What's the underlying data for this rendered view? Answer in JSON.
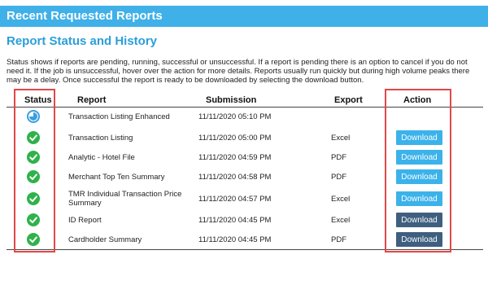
{
  "header": {
    "title": "Recent Requested Reports"
  },
  "section": {
    "title": "Report Status and History",
    "description": "Status shows if reports are pending, running, successful or unsuccessful. If a report is pending there is an option to cancel if you do not need it. If the job is unsuccessful, hover over the action for more details. Reports usually run quickly but during high volume peaks there may be a delay. Once successful the report is ready to be downloaded by selecting the download button."
  },
  "table": {
    "columns": {
      "status": "Status",
      "report": "Report",
      "submission": "Submission",
      "export": "Export",
      "action": "Action"
    },
    "rows": [
      {
        "status": "running",
        "report": "Transaction Listing Enhanced",
        "submission": "11/11/2020 05:10 PM",
        "export": "",
        "action": ""
      },
      {
        "status": "success",
        "report": "Transaction Listing",
        "submission": "11/11/2020 05:00 PM",
        "export": "Excel",
        "action": "Download"
      },
      {
        "status": "success",
        "report": "Analytic - Hotel File",
        "submission": "11/11/2020 04:59 PM",
        "export": "PDF",
        "action": "Download"
      },
      {
        "status": "success",
        "report": "Merchant Top Ten Summary",
        "submission": "11/11/2020 04:58 PM",
        "export": "PDF",
        "action": "Download"
      },
      {
        "status": "success",
        "report": "TMR Individual Transaction Price Summary",
        "submission": "11/11/2020 04:57 PM",
        "export": "Excel",
        "action": "Download"
      },
      {
        "status": "success",
        "report": "ID Report",
        "submission": "11/11/2020 04:45 PM",
        "export": "Excel",
        "action": "Download"
      },
      {
        "status": "success",
        "report": "Cardholder Summary",
        "submission": "11/11/2020 04:45 PM",
        "export": "PDF",
        "action": "Download"
      }
    ]
  },
  "colors": {
    "header_bg": "#3fb0e8",
    "title": "#2a9fd8",
    "success_icon": "#2fb24a",
    "running_icon": "#3a9ee0",
    "download_light": "#3cb2ea",
    "download_dark": "#3f5f7f",
    "highlight": "#e04848"
  },
  "icons": {
    "success": "check-circle-icon",
    "running": "progress-circle-icon"
  },
  "button_styles": [
    "light",
    "light",
    "light",
    "light",
    "dark",
    "dark"
  ]
}
